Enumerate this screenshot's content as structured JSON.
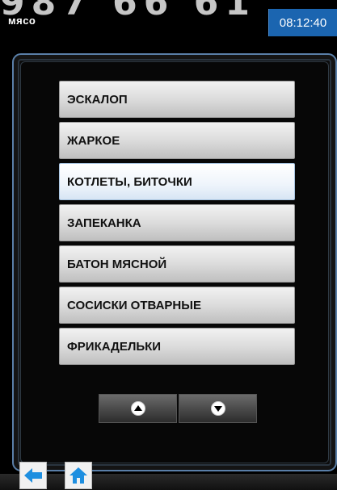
{
  "watermark": "987 66 61",
  "header": {
    "title": "мясо",
    "clock": "08:12:40"
  },
  "menu": {
    "items": [
      {
        "label": "ЭСКАЛОП"
      },
      {
        "label": "ЖАРКОЕ"
      },
      {
        "label": "КОТЛЕТЫ, БИТОЧКИ"
      },
      {
        "label": "ЗАПЕКАНКА"
      },
      {
        "label": "БАТОН МЯСНОЙ"
      },
      {
        "label": "СОСИСКИ ОТВАРНЫЕ"
      },
      {
        "label": "ФРИКАДЕЛЬКИ"
      }
    ]
  },
  "icons": {
    "scroll_up": "arrow-up-circle-icon",
    "scroll_down": "arrow-down-circle-icon",
    "back": "arrow-left-icon",
    "home": "home-icon"
  },
  "colors": {
    "accent": "#1b65b0",
    "panel_border": "#5a7fa8",
    "icon_blue": "#1e8fe0"
  }
}
